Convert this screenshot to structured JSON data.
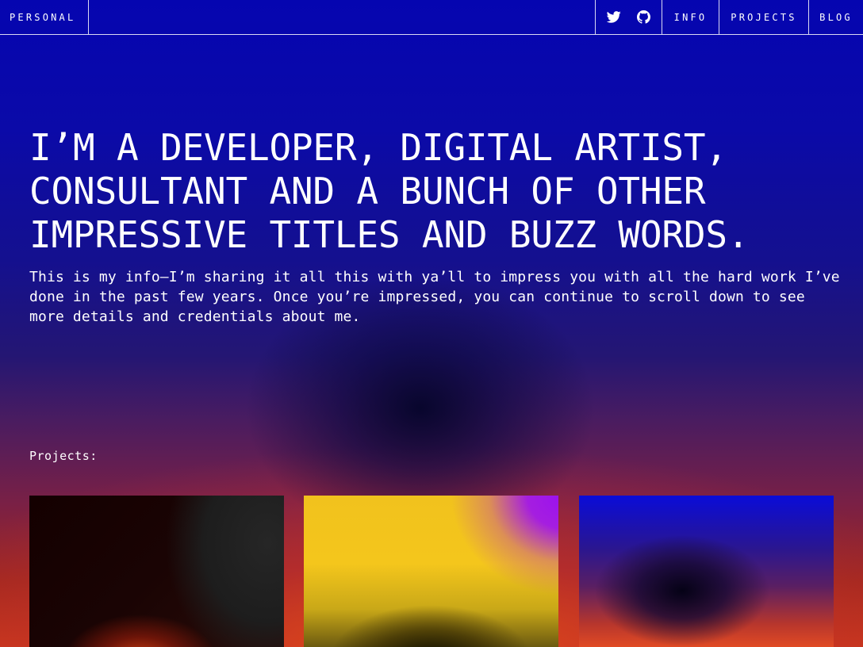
{
  "nav": {
    "brand": "PERSONAL",
    "icons": [
      "twitter-icon",
      "github-icon"
    ],
    "links": [
      "INFO",
      "PROJECTS",
      "BLOG"
    ]
  },
  "hero": {
    "headline": "I’m a developer, digital artist, consultant and a bunch of other impressive titles and buzz words.",
    "intro": "This is my info—I’m sharing it all this with ya’ll to impress you with all the hard work I’ve done in the past few years. Once you’re impressed, you can continue to scroll down to see more details and credentials about me."
  },
  "projects": {
    "label": "Projects:"
  },
  "colors": {
    "text": "#ffffff",
    "top_blue": "#0505b0",
    "bottom_orange": "#c7361a"
  }
}
